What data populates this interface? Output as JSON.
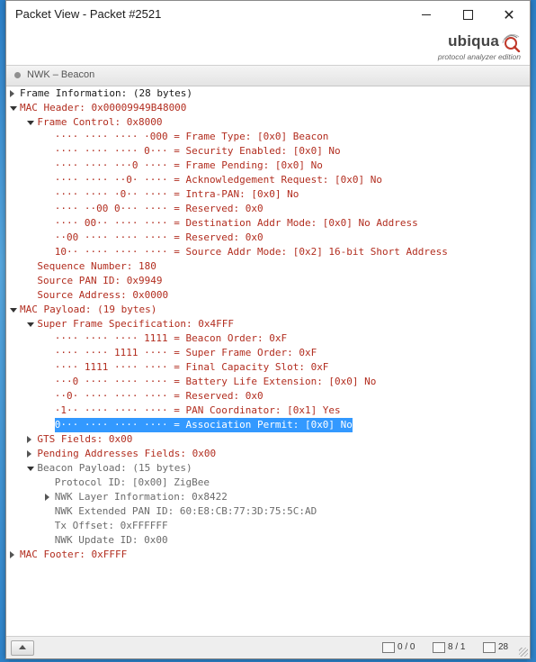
{
  "window": {
    "title": "Packet View - Packet #2521",
    "controls": {
      "minimize": "minimize",
      "maximize": "maximize",
      "close": "close"
    }
  },
  "brand": {
    "name": "ubiqua",
    "tagline": "protocol analyzer edition"
  },
  "section": {
    "label": "NWK – Beacon"
  },
  "tree": [
    {
      "text": "Frame Information: (28 bytes)",
      "depth": 0,
      "toggle": "closed",
      "color": "black"
    },
    {
      "text": "MAC Header: 0x00009949B48000",
      "depth": 0,
      "toggle": "open",
      "color": "red"
    },
    {
      "text": "Frame Control: 0x8000",
      "depth": 1,
      "toggle": "open",
      "color": "red"
    },
    {
      "text": "···· ···· ···· ·000 = Frame Type: [0x0] Beacon",
      "depth": 2,
      "toggle": "none",
      "color": "red"
    },
    {
      "text": "···· ···· ···· 0··· = Security Enabled: [0x0] No",
      "depth": 2,
      "toggle": "none",
      "color": "red"
    },
    {
      "text": "···· ···· ···0 ···· = Frame Pending: [0x0] No",
      "depth": 2,
      "toggle": "none",
      "color": "red"
    },
    {
      "text": "···· ···· ··0· ···· = Acknowledgement Request: [0x0] No",
      "depth": 2,
      "toggle": "none",
      "color": "red"
    },
    {
      "text": "···· ···· ·0·· ···· = Intra-PAN: [0x0] No",
      "depth": 2,
      "toggle": "none",
      "color": "red"
    },
    {
      "text": "···· ··00 0··· ···· = Reserved: 0x0",
      "depth": 2,
      "toggle": "none",
      "color": "red"
    },
    {
      "text": "···· 00·· ···· ···· = Destination Addr Mode: [0x0] No Address",
      "depth": 2,
      "toggle": "none",
      "color": "red"
    },
    {
      "text": "··00 ···· ···· ···· = Reserved: 0x0",
      "depth": 2,
      "toggle": "none",
      "color": "red"
    },
    {
      "text": "10·· ···· ···· ···· = Source Addr Mode: [0x2] 16-bit Short Address",
      "depth": 2,
      "toggle": "none",
      "color": "red"
    },
    {
      "text": "Sequence Number: 180",
      "depth": 1,
      "toggle": "none",
      "color": "red"
    },
    {
      "text": "Source PAN ID: 0x9949",
      "depth": 1,
      "toggle": "none",
      "color": "red"
    },
    {
      "text": "Source Address: 0x0000",
      "depth": 1,
      "toggle": "none",
      "color": "red"
    },
    {
      "text": "MAC Payload: (19 bytes)",
      "depth": 0,
      "toggle": "open",
      "color": "red"
    },
    {
      "text": "Super Frame Specification: 0x4FFF",
      "depth": 1,
      "toggle": "open",
      "color": "red"
    },
    {
      "text": "···· ···· ···· 1111 = Beacon Order: 0xF",
      "depth": 2,
      "toggle": "none",
      "color": "red"
    },
    {
      "text": "···· ···· 1111 ···· = Super Frame Order: 0xF",
      "depth": 2,
      "toggle": "none",
      "color": "red"
    },
    {
      "text": "···· 1111 ···· ···· = Final Capacity Slot: 0xF",
      "depth": 2,
      "toggle": "none",
      "color": "red"
    },
    {
      "text": "···0 ···· ···· ···· = Battery Life Extension: [0x0] No",
      "depth": 2,
      "toggle": "none",
      "color": "red"
    },
    {
      "text": "··0· ···· ···· ···· = Reserved: 0x0",
      "depth": 2,
      "toggle": "none",
      "color": "red"
    },
    {
      "text": "·1·· ···· ···· ···· = PAN Coordinator: [0x1] Yes",
      "depth": 2,
      "toggle": "none",
      "color": "red"
    },
    {
      "text": "0··· ···· ···· ···· = Association Permit: [0x0] No",
      "depth": 2,
      "toggle": "none",
      "color": "red",
      "selected": true
    },
    {
      "text": "GTS Fields: 0x00",
      "depth": 1,
      "toggle": "closed",
      "color": "red"
    },
    {
      "text": "Pending Addresses Fields: 0x00",
      "depth": 1,
      "toggle": "closed",
      "color": "red"
    },
    {
      "text": "Beacon Payload: (15 bytes)",
      "depth": 1,
      "toggle": "open",
      "color": "gray"
    },
    {
      "text": "Protocol ID: [0x00] ZigBee",
      "depth": 2,
      "toggle": "none",
      "color": "gray"
    },
    {
      "text": "NWK Layer Information: 0x8422",
      "depth": 2,
      "toggle": "closed",
      "color": "gray"
    },
    {
      "text": "NWK Extended PAN ID: 60:E8:CB:77:3D:75:5C:AD",
      "depth": 2,
      "toggle": "none",
      "color": "gray"
    },
    {
      "text": "Tx Offset: 0xFFFFFF",
      "depth": 2,
      "toggle": "none",
      "color": "gray"
    },
    {
      "text": "NWK Update ID: 0x00",
      "depth": 2,
      "toggle": "none",
      "color": "gray"
    },
    {
      "text": "MAC Footer: 0xFFFF",
      "depth": 0,
      "toggle": "closed",
      "color": "red"
    }
  ],
  "status": {
    "frames": "0 / 0",
    "pages": "8 / 1",
    "bytes": "28"
  },
  "colors": {
    "red": "#b22d1f",
    "gray": "#6b6b6b",
    "selection": "#3399ff"
  }
}
